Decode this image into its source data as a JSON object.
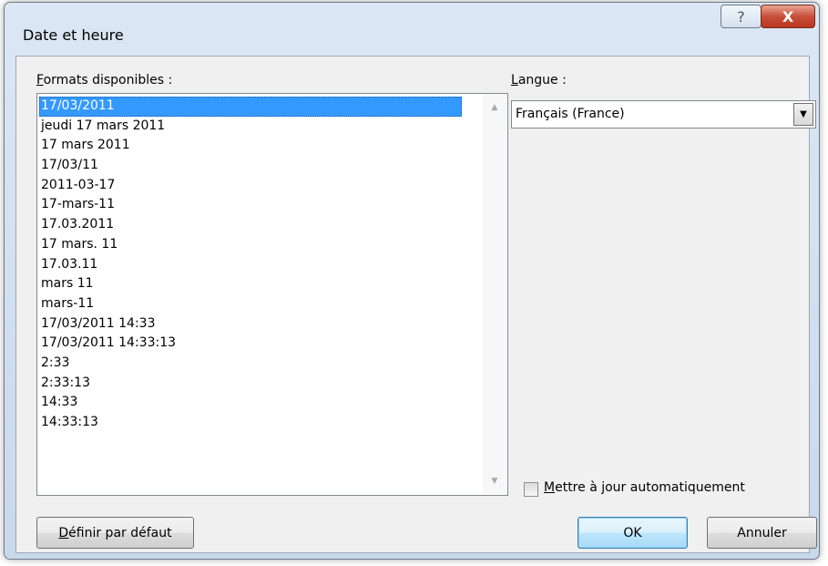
{
  "window": {
    "title": "Date et heure",
    "help_glyph": "?",
    "close_glyph": "X"
  },
  "formats": {
    "label_accel": "F",
    "label_rest": "ormats disponibles :",
    "items": [
      "17/03/2011",
      "jeudi 17 mars 2011",
      "17 mars 2011",
      "17/03/11",
      "2011-03-17",
      "17-mars-11",
      "17.03.2011",
      "17 mars. 11",
      "17.03.11",
      "mars 11",
      "mars-11",
      "17/03/2011 14:33",
      "17/03/2011 14:33:13",
      "2:33",
      "2:33:13",
      "14:33",
      "14:33:13"
    ],
    "selected_index": 0
  },
  "language": {
    "label_accel": "L",
    "label_rest": "angue :",
    "value": "Français (France)"
  },
  "auto_update": {
    "label_accel": "M",
    "label_rest": "ettre à jour automatiquement",
    "checked": false
  },
  "buttons": {
    "set_default_accel": "D",
    "set_default_rest": "éfinir par défaut",
    "ok": "OK",
    "cancel": "Annuler"
  }
}
